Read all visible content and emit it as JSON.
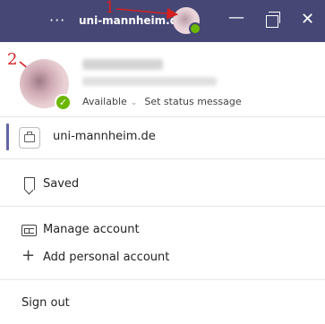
{
  "titlebar": {
    "more_label": "···",
    "org_name": "uni-mannheim.de",
    "accent_color": "#464775"
  },
  "annotations": {
    "marker_1": "1",
    "marker_2": "2",
    "color": "#d42020"
  },
  "profile": {
    "status": "Available",
    "set_status": "Set status message",
    "presence_color": "#6bb700"
  },
  "org": {
    "label": "uni-mannheim.de",
    "indicator_color": "#6264a7"
  },
  "menu": {
    "saved": "Saved",
    "manage_account": "Manage account",
    "add_personal": "Add personal account",
    "sign_out": "Sign out"
  },
  "icons": {
    "more": "more-options-icon",
    "minimize": "minimize-icon",
    "maximize": "maximize-icon",
    "close": "close-icon",
    "org": "briefcase-icon",
    "saved": "bookmark-icon",
    "manage": "id-card-icon",
    "add": "plus-icon"
  }
}
